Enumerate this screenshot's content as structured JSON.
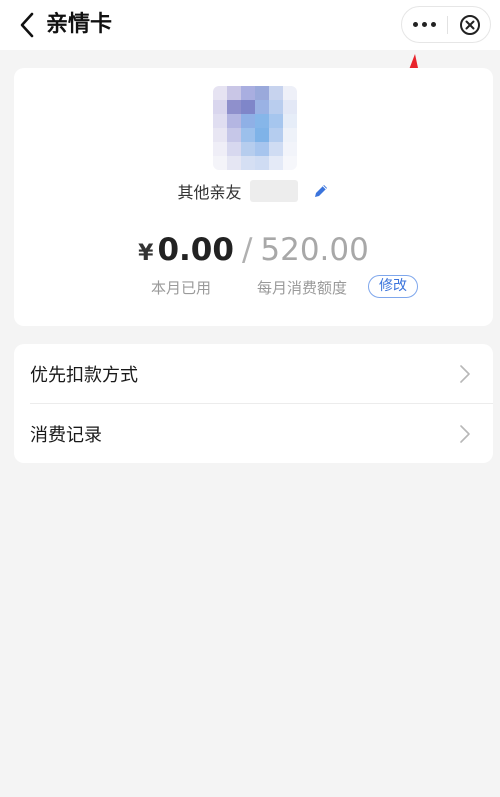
{
  "header": {
    "title": "亲情卡",
    "back_icon": "chevron-left-icon",
    "more_icon": "more-horizontal-icon",
    "close_icon": "close-circle-icon"
  },
  "card": {
    "member_label": "其他亲友",
    "edit_name_icon": "pencil-icon",
    "currency_symbol": "¥",
    "used_amount": "0.00",
    "separator": "/",
    "monthly_limit": "520.00",
    "used_caption": "本月已用",
    "limit_caption": "每月消费额度",
    "edit_button": "修改"
  },
  "menu": {
    "items": [
      {
        "label": "优先扣款方式",
        "icon": "chevron-right-icon"
      },
      {
        "label": "消费记录",
        "icon": "chevron-right-icon"
      }
    ]
  },
  "colors": {
    "accent_blue": "#3b74dc",
    "annotation_red": "#e8232b",
    "background": "#f4f4f4"
  }
}
